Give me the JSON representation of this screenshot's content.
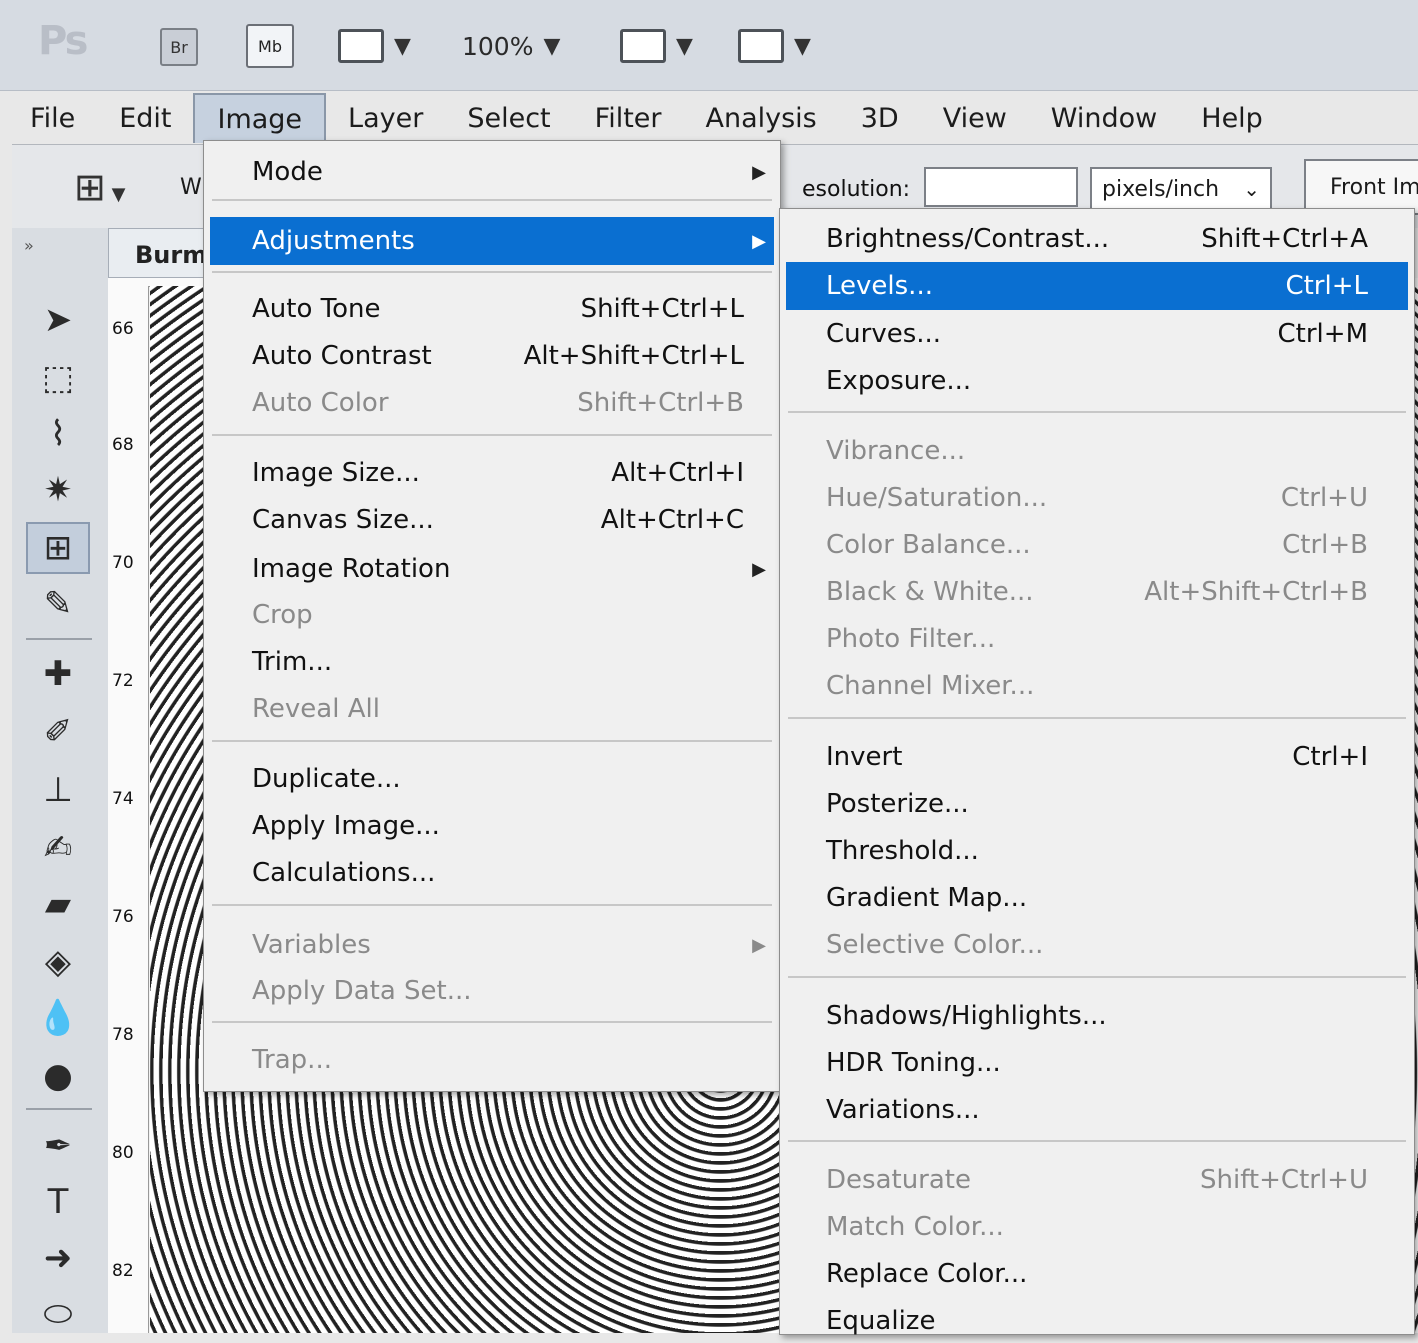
{
  "app": {
    "logo": "Ps",
    "bridge_label": "Br",
    "mini_bridge_label": "Mb",
    "zoom": "100%"
  },
  "menubar": [
    "File",
    "Edit",
    "Image",
    "Layer",
    "Select",
    "Filter",
    "Analysis",
    "3D",
    "View",
    "Window",
    "Help"
  ],
  "options_bar": {
    "width_label_fragment": "W",
    "resolution_label": "esolution:",
    "resolution_value": "",
    "units": "pixels/inch",
    "front_image_button": "Front Im"
  },
  "document": {
    "tab_title": "Burm",
    "ruler_labels": [
      "66",
      "68",
      "70",
      "72",
      "74",
      "76",
      "78",
      "80",
      "82"
    ]
  },
  "image_menu": {
    "items": [
      {
        "label": "Mode",
        "shortcut": "",
        "submenu": true,
        "disabled": false
      },
      {
        "label": "Adjustments",
        "shortcut": "",
        "submenu": true,
        "disabled": false,
        "highlighted": true
      },
      {
        "label": "Auto Tone",
        "shortcut": "Shift+Ctrl+L",
        "disabled": false
      },
      {
        "label": "Auto Contrast",
        "shortcut": "Alt+Shift+Ctrl+L",
        "disabled": false
      },
      {
        "label": "Auto Color",
        "shortcut": "Shift+Ctrl+B",
        "disabled": true
      },
      {
        "label": "Image Size...",
        "shortcut": "Alt+Ctrl+I",
        "disabled": false
      },
      {
        "label": "Canvas Size...",
        "shortcut": "Alt+Ctrl+C",
        "disabled": false
      },
      {
        "label": "Image Rotation",
        "shortcut": "",
        "submenu": true,
        "disabled": false
      },
      {
        "label": "Crop",
        "shortcut": "",
        "disabled": true
      },
      {
        "label": "Trim...",
        "shortcut": "",
        "disabled": false
      },
      {
        "label": "Reveal All",
        "shortcut": "",
        "disabled": true
      },
      {
        "label": "Duplicate...",
        "shortcut": "",
        "disabled": false
      },
      {
        "label": "Apply Image...",
        "shortcut": "",
        "disabled": false
      },
      {
        "label": "Calculations...",
        "shortcut": "",
        "disabled": false
      },
      {
        "label": "Variables",
        "shortcut": "",
        "submenu": true,
        "disabled": true
      },
      {
        "label": "Apply Data Set...",
        "shortcut": "",
        "disabled": true
      },
      {
        "label": "Trap...",
        "shortcut": "",
        "disabled": true
      }
    ]
  },
  "adjustments_menu": {
    "items": [
      {
        "label": "Brightness/Contrast...",
        "shortcut": "Shift+Ctrl+A",
        "disabled": false
      },
      {
        "label": "Levels...",
        "shortcut": "Ctrl+L",
        "disabled": false,
        "highlighted": true
      },
      {
        "label": "Curves...",
        "shortcut": "Ctrl+M",
        "disabled": false
      },
      {
        "label": "Exposure...",
        "shortcut": "",
        "disabled": false
      },
      {
        "label": "Vibrance...",
        "shortcut": "",
        "disabled": true
      },
      {
        "label": "Hue/Saturation...",
        "shortcut": "Ctrl+U",
        "disabled": true
      },
      {
        "label": "Color Balance...",
        "shortcut": "Ctrl+B",
        "disabled": true
      },
      {
        "label": "Black & White...",
        "shortcut": "Alt+Shift+Ctrl+B",
        "disabled": true
      },
      {
        "label": "Photo Filter...",
        "shortcut": "",
        "disabled": true
      },
      {
        "label": "Channel Mixer...",
        "shortcut": "",
        "disabled": true
      },
      {
        "label": "Invert",
        "shortcut": "Ctrl+I",
        "disabled": false
      },
      {
        "label": "Posterize...",
        "shortcut": "",
        "disabled": false
      },
      {
        "label": "Threshold...",
        "shortcut": "",
        "disabled": false
      },
      {
        "label": "Gradient Map...",
        "shortcut": "",
        "disabled": false
      },
      {
        "label": "Selective Color...",
        "shortcut": "",
        "disabled": true
      },
      {
        "label": "Shadows/Highlights...",
        "shortcut": "",
        "disabled": false
      },
      {
        "label": "HDR Toning...",
        "shortcut": "",
        "disabled": false
      },
      {
        "label": "Variations...",
        "shortcut": "",
        "disabled": false
      },
      {
        "label": "Desaturate",
        "shortcut": "Shift+Ctrl+U",
        "disabled": true
      },
      {
        "label": "Match Color...",
        "shortcut": "",
        "disabled": true
      },
      {
        "label": "Replace Color...",
        "shortcut": "",
        "disabled": false
      },
      {
        "label": "Equalize",
        "shortcut": "",
        "disabled": false
      }
    ]
  },
  "colors": {
    "highlight": "#0a6fd1",
    "disabled_text": "#8a8a8a"
  }
}
